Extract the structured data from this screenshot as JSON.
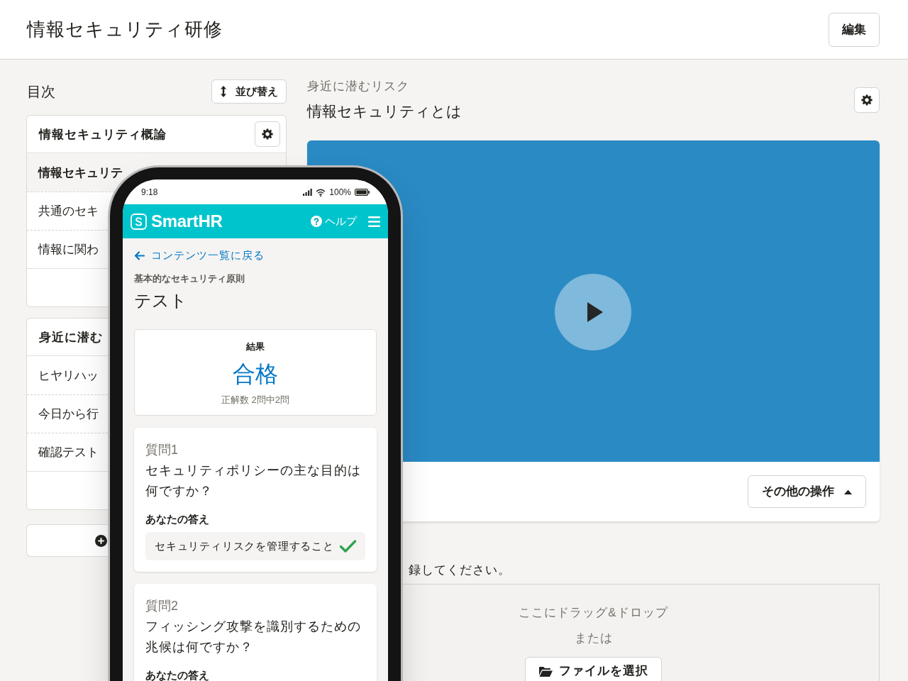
{
  "header": {
    "title": "情報セキュリティ研修",
    "edit_button": "編集"
  },
  "sidebar": {
    "title": "目次",
    "sort_button": "並び替え",
    "sections": [
      {
        "title": "情報セキュリティ概論",
        "settings_button": true,
        "items": [
          {
            "label": "情報セキュリテ",
            "selected": true
          },
          {
            "label": "共通のセキ",
            "selected": false
          },
          {
            "label": "情報に関わ",
            "selected": false
          }
        ]
      },
      {
        "title": "身近に潜む",
        "items": [
          {
            "label": "ヒヤリハッ",
            "selected": false
          },
          {
            "label": "今日から行",
            "selected": false
          },
          {
            "label": "確認テスト",
            "selected": false
          }
        ]
      }
    ]
  },
  "content": {
    "section_label": "身近に潜むリスク",
    "title": "情報セキュリティとは",
    "more_actions_button": "その他の操作",
    "upload": {
      "instruction": "録してください。",
      "drop_hint": "ここにドラッグ&ドロップ",
      "separator": "または",
      "select_button": "ファイルを選択"
    }
  },
  "phone": {
    "status_bar": {
      "time": "9:18",
      "battery": "100%"
    },
    "app_bar": {
      "logo": "SmartHR",
      "help": "ヘルプ"
    },
    "back_link": "コンテンツ一覧に戻る",
    "category": "基本的なセキュリティ原則",
    "title": "テスト",
    "result": {
      "label": "結果",
      "verdict": "合格",
      "score": "正解数 2問中2問"
    },
    "questions": [
      {
        "number": "質問1",
        "text": "セキュリティポリシーの主な目的は何ですか？",
        "answer_label": "あなたの答え",
        "answer": "セキュリティリスクを管理すること",
        "correct": true
      },
      {
        "number": "質問2",
        "text": "フィッシング攻撃を識別するための兆候は何ですか？",
        "answer_label": "あなたの答え"
      }
    ]
  }
}
